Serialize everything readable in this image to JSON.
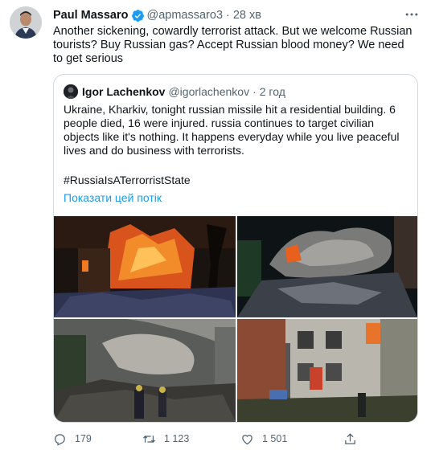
{
  "tweet": {
    "author_name": "Paul Massaro",
    "author_handle": "@apmassaro3",
    "separator": "·",
    "time": "28 хв",
    "text": "Another sickening, cowardly terrorist attack. But we welcome Russian tourists? Buy Russian gas? Accept Russian blood money? We need to get serious",
    "verified_color": "#1d9bf0"
  },
  "quote": {
    "author_name": "Igor Lachenkov",
    "author_handle": "@igorlachenkov",
    "separator": "·",
    "time": "2 год",
    "text": "Ukraine, Kharkiv, tonight russian missile hit a residential building. 6 people died, 16 were injured. russia continues to target civilian objects like it's nothing. It happens everyday while you live peaceful lives and do business with terrorists.",
    "hashtag": "#RussiaIsATerrorristState",
    "show_thread_label": "Показати цей потік",
    "link_color": "#1d9bf0"
  },
  "actions": {
    "reply_count": "179",
    "retweet_count": "1 123",
    "like_count": "1 501"
  }
}
